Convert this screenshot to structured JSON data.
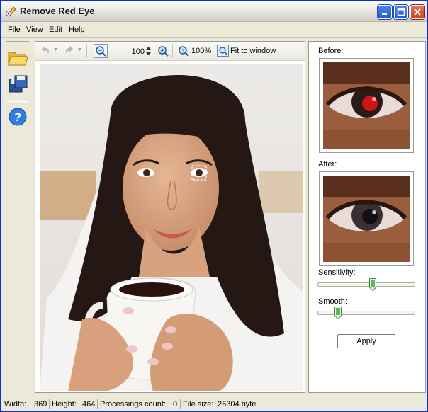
{
  "window": {
    "title": "Remove Red Eye"
  },
  "menu": [
    "File",
    "View",
    "Edit",
    "Help"
  ],
  "sidebar": [
    {
      "icon": "open-folder-icon"
    },
    {
      "icon": "save-icon"
    },
    {
      "icon": "help-icon"
    }
  ],
  "toolbar": {
    "undo_icon": "undo-icon",
    "redo_icon": "redo-icon",
    "zoom_out_icon": "zoom-out-icon",
    "zoom_value": "100",
    "zoom_in_icon": "zoom-in-icon",
    "actual_size_label": "100%",
    "fit_label": "Fit to window"
  },
  "preview": {
    "before_label": "Before:",
    "after_label": "After:"
  },
  "controls": {
    "sensitivity_label": "Sensitivity:",
    "sensitivity_value": 0.57,
    "smooth_label": "Smooth:",
    "smooth_value": 0.19,
    "apply_label": "Apply"
  },
  "status": {
    "width_label": "Width:",
    "width_value": "369",
    "height_label": "Height:",
    "height_value": "464",
    "count_label": "Processings count:",
    "count_value": "0",
    "filesize_label": "File size:",
    "filesize_value": "26304 byte"
  },
  "colors": {
    "accent": "#2459d7",
    "close": "#c9421f"
  }
}
